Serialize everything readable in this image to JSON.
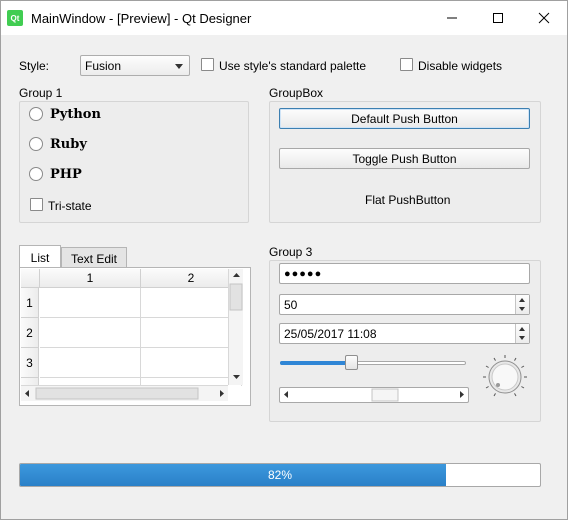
{
  "window": {
    "title": "MainWindow - [Preview] - Qt Designer",
    "icon_label": "Qt",
    "controls": {
      "minimize": "minimize-icon",
      "maximize": "maximize-icon",
      "close": "close-icon"
    }
  },
  "toolbar": {
    "style_label": "Style:",
    "style_value": "Fusion",
    "standard_palette_label": "Use style's standard palette",
    "standard_palette_checked": false,
    "disable_widgets_label": "Disable widgets",
    "disable_widgets_checked": false
  },
  "group1": {
    "title": "Group 1",
    "radios": [
      {
        "label": "Python",
        "checked": false
      },
      {
        "label": "Ruby",
        "checked": false
      },
      {
        "label": "PHP",
        "checked": false
      }
    ],
    "tristate_label": "Tri-state",
    "tristate_checked": false
  },
  "groupbox": {
    "title": "GroupBox",
    "default_button": "Default Push Button",
    "toggle_button": "Toggle Push Button",
    "flat_button": "Flat PushButton"
  },
  "tabs": {
    "items": [
      {
        "label": "List",
        "active": true
      },
      {
        "label": "Text Edit",
        "active": false
      }
    ],
    "table": {
      "columns": [
        "1",
        "2"
      ],
      "rows": [
        "1",
        "2",
        "3"
      ]
    }
  },
  "group3": {
    "title": "Group 3",
    "password_mask": "●●●●●",
    "spin_value": "50",
    "datetime_value": "25/05/2017 11:08",
    "slider_value_fraction": 0.38
  },
  "progress": {
    "value": 82,
    "label": "82%"
  },
  "colors": {
    "accent": "#2a80c8",
    "window_bg": "#f0f0f0"
  }
}
